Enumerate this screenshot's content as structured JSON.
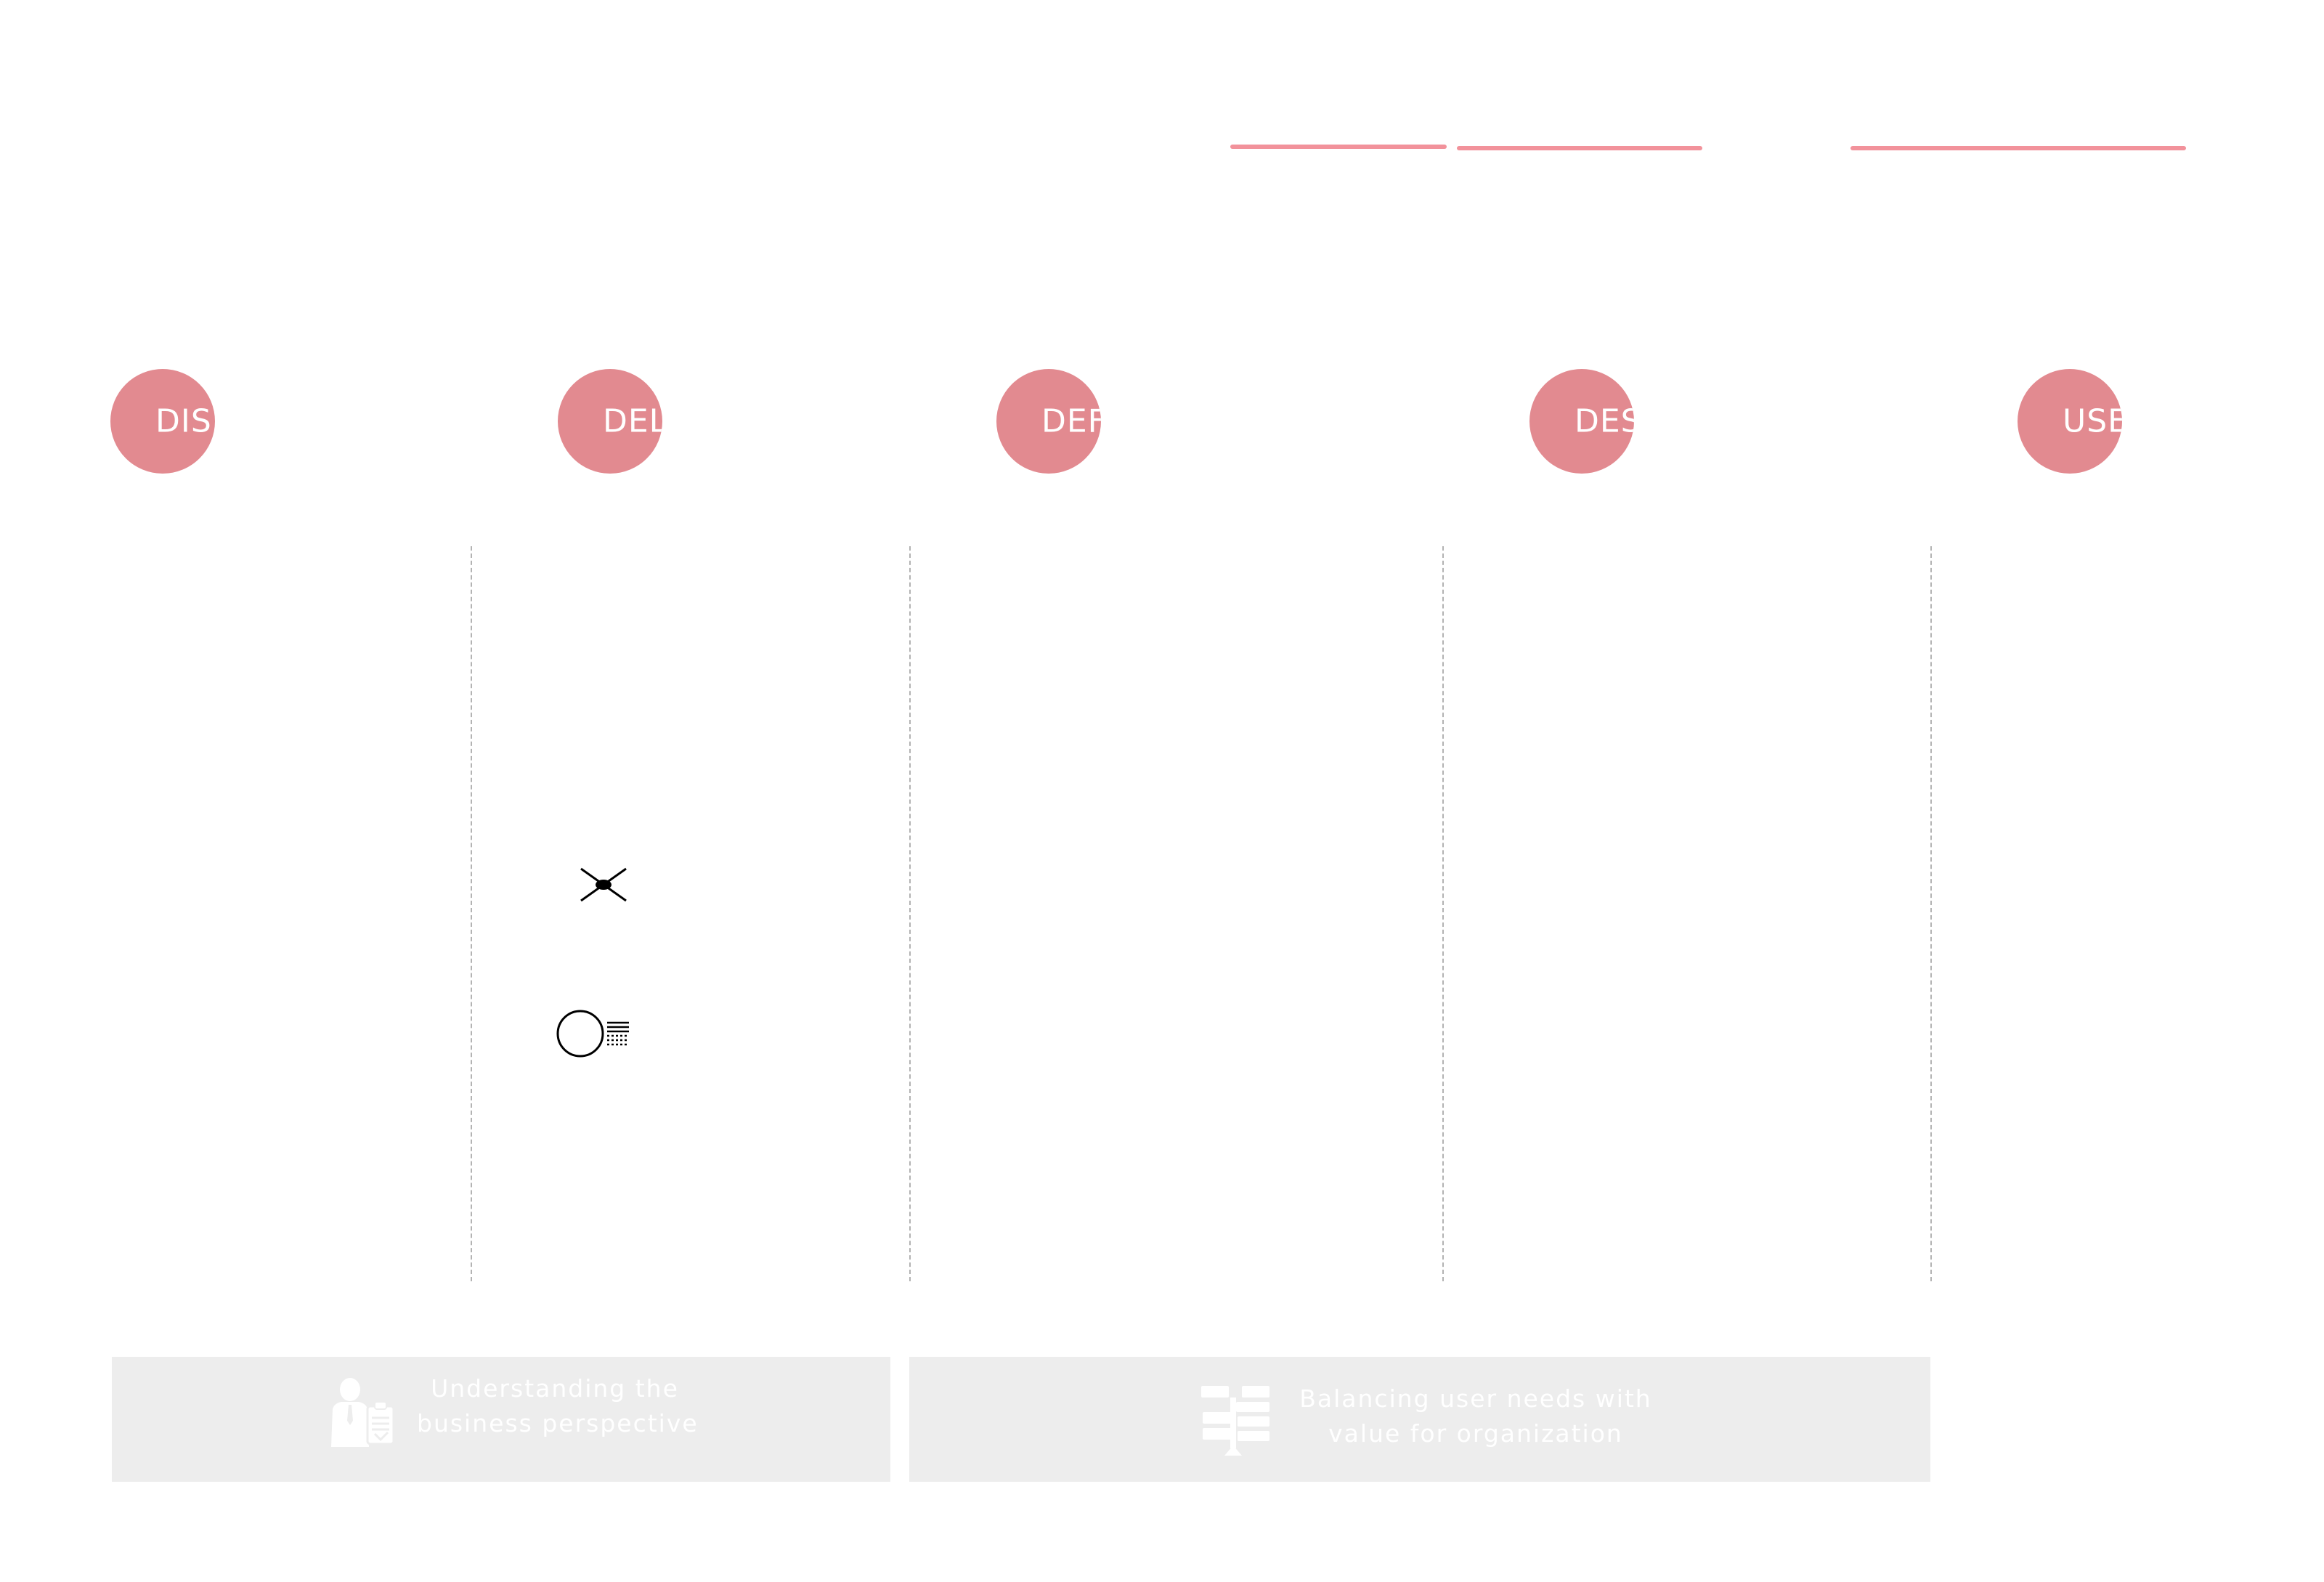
{
  "colors": {
    "accent_rule": "#f2929b",
    "phase_circle": "#e28a90",
    "divider": "#b3b3b3",
    "panel_background": "#ededed",
    "panel_text": "#ffffff"
  },
  "phases": [
    {
      "label": "DIS"
    },
    {
      "label": "DEL"
    },
    {
      "label": "DEF"
    },
    {
      "label": "DES"
    },
    {
      "label": "USE"
    }
  ],
  "symbols": [
    {
      "icon": "exclusive-gateway-x-icon"
    },
    {
      "icon": "conditional-event-icon"
    }
  ],
  "panels": [
    {
      "icon": "business-person-clipboard-icon",
      "line1": "Understanding the",
      "line2": "business perspective"
    },
    {
      "icon": "balance-scale-cards-icon",
      "line1": "Balancing user needs with",
      "line2": "value for organization"
    }
  ]
}
